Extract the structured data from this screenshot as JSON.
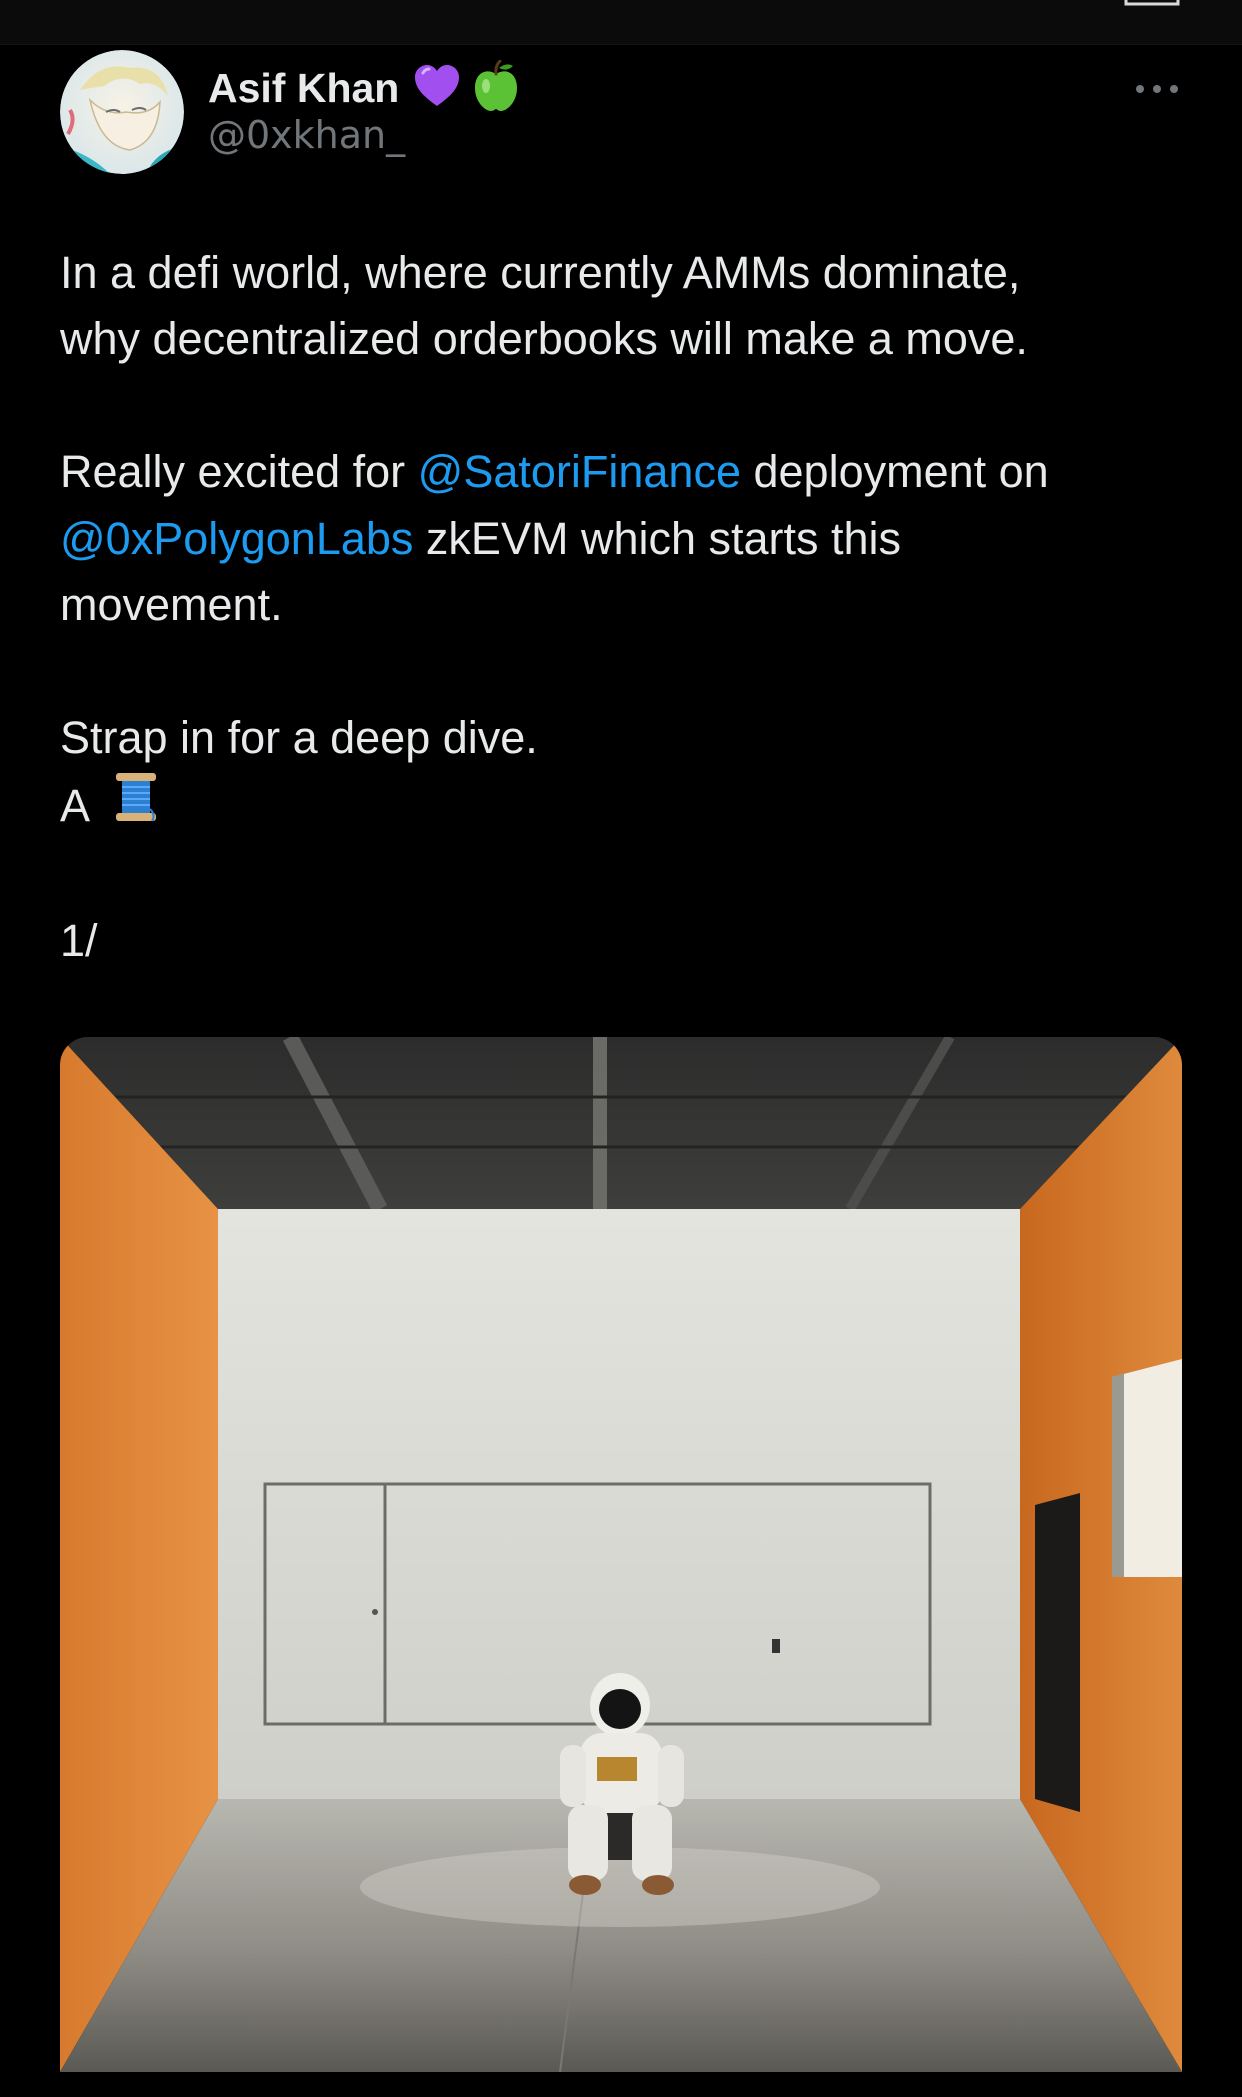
{
  "tweet": {
    "author": {
      "display_name": "Asif Khan",
      "handle": "@0xkhan_",
      "badges": [
        "purple-heart-icon",
        "green-apple-icon"
      ]
    },
    "more_label": "More options",
    "paragraphs": {
      "p1_line1": "In a defi world, where currently AMMs dominate,",
      "p1_line2": "why decentralized orderbooks will make a move.",
      "p2_pre": "Really excited for ",
      "p2_mention1": "@SatoriFinance",
      "p2_mid": " deployment on",
      "p2_mention2": "@0xPolygonLabs",
      "p2_post": " zkEVM which starts this",
      "p2_line3": "movement.",
      "p3_line1": "Strap in for a deep dive.",
      "p3_line2": "A",
      "p4": "1/"
    },
    "media": {
      "alt": "Astronaut sitting on a small stool in an empty room with orange walls",
      "icon": "photo"
    }
  },
  "colors": {
    "background": "#000000",
    "text": "#e7e9ea",
    "secondary": "#71767b",
    "link": "#1d9bf0"
  }
}
